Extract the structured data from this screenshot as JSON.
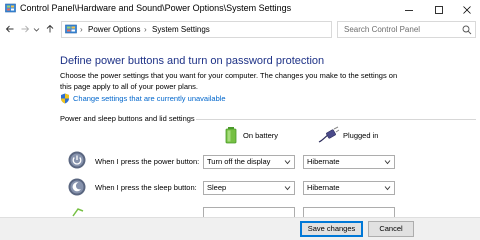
{
  "window": {
    "title": "Control Panel\\Hardware and Sound\\Power Options\\System Settings"
  },
  "address": {
    "crumbs": [
      "Power Options",
      "System Settings"
    ],
    "separator": "›",
    "search_placeholder": "Search Control Panel"
  },
  "main": {
    "heading": "Define power buttons and turn on password protection",
    "description": "Choose the power settings that you want for your computer. The changes you make to the settings on this page apply to all of your power plans.",
    "admin_link": "Change settings that are currently unavailable",
    "section_title": "Power and sleep buttons and lid settings",
    "columns": {
      "battery": "On battery",
      "plugged": "Plugged in"
    },
    "rows": [
      {
        "label": "When I press the power button:",
        "battery": "Turn off the display",
        "plugged": "Hibernate"
      },
      {
        "label": "When I press the sleep button:",
        "battery": "Sleep",
        "plugged": "Hibernate"
      }
    ]
  },
  "footer": {
    "save": "Save changes",
    "cancel": "Cancel"
  },
  "colors": {
    "heading": "#1e3287",
    "link": "#0066cc",
    "accent": "#0078d7"
  }
}
